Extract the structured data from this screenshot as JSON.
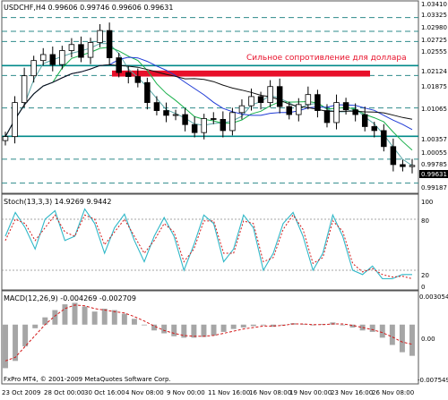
{
  "main_panel": {
    "header": "USDCHF,H4  0.99606 0.99746 0.99606 0.99631",
    "annotation": "Сильное сопротивление для доллара",
    "price_labels": [
      "1.03410",
      "1.03325",
      "1.02980",
      "1.02725",
      "1.02555",
      "1.02124",
      "1.01875",
      "1.01065",
      "1.00357",
      "1.00055",
      "0.99785",
      "0.99631",
      "0.99187"
    ]
  },
  "stoch_panel": {
    "header": "Stoch(13,3,3)  14.9269  9.9442",
    "scale": [
      "100",
      "80",
      "20",
      "0"
    ]
  },
  "macd_panel": {
    "header": "MACD(12,26,9) -0.004269 -0.002709",
    "scale": [
      "0.003054",
      "0.00",
      "-0.007549"
    ]
  },
  "footer": {
    "copyright": "FxPro MT4, © 2001-2009 MetaQuotes Software Corp.",
    "x_labels": [
      "23 Oct 2009",
      "28 Oct 00:00",
      "30 Oct 16:00",
      "4 Nov 08:00",
      "9 Nov 00:00",
      "11 Nov 16:00",
      "16 Nov 08:00",
      "19 Nov 00:00",
      "23 Nov 16:00",
      "26 Nov 08:00"
    ]
  },
  "colors": {
    "background": "#ffffff",
    "bull_candle": "#ffffff",
    "bear_candle": "#000000",
    "resistance_zone": "#e8102a",
    "resistance_line": "#008a8a",
    "dashed_levels": "#2e8b8b",
    "ma_blue": "#1f3bd6",
    "ma_green": "#18b04a",
    "ma_black": "#111111",
    "ma_teal": "#5aa7a7",
    "stoch_main": "#30b8c8",
    "stoch_signal": "#d21818",
    "macd_hist": "#a6a6a6",
    "macd_signal": "#d21818",
    "current_price_bg": "#000000"
  },
  "chart_data": [
    {
      "type": "line",
      "title": "USDCHF,H4",
      "series": [
        {
          "name": "USDCHF",
          "values": [
            1.0035,
            1.012,
            1.0187,
            1.0225,
            1.024,
            1.0215,
            1.025,
            1.0265,
            1.0233,
            1.027,
            1.03,
            1.0232,
            1.0195,
            1.0185,
            1.017,
            1.012,
            1.01,
            1.0088,
            1.009,
            1.0065,
            1.0045,
            1.008,
            1.0078,
            1.005,
            1.0095,
            1.0112,
            1.0135,
            1.012,
            1.016,
            1.011,
            1.009,
            1.0115,
            1.014,
            1.01,
            1.007,
            1.012,
            1.0102,
            1.009,
            1.006,
            1.005,
            1.001,
            0.9965,
            0.996,
            0.9963
          ]
        }
      ],
      "ylim": [
        0.99,
        1.0345
      ],
      "resistance_zone": [
        1.0185,
        1.02
      ],
      "horizontal_levels": [
        1.03325,
        1.0298,
        1.02725,
        1.02124,
        1.01875,
        1.01065,
        1.00357,
        0.99785,
        0.99187
      ],
      "grid": true
    },
    {
      "type": "line",
      "title": "Stoch(13,3,3)",
      "series": [
        {
          "name": "Stoch main",
          "values": [
            60,
            88,
            70,
            45,
            80,
            90,
            55,
            60,
            92,
            75,
            40,
            70,
            86,
            55,
            30,
            60,
            82,
            60,
            20,
            50,
            85,
            75,
            30,
            45,
            85,
            70,
            20,
            40,
            75,
            88,
            60,
            20,
            40,
            85,
            60,
            20,
            15,
            25,
            10,
            10,
            15,
            15
          ]
        },
        {
          "name": "Stoch signal",
          "values": [
            55,
            80,
            75,
            55,
            70,
            85,
            65,
            60,
            85,
            80,
            50,
            65,
            80,
            60,
            40,
            55,
            75,
            65,
            30,
            45,
            78,
            78,
            40,
            40,
            78,
            75,
            30,
            35,
            68,
            85,
            68,
            28,
            35,
            78,
            66,
            28,
            18,
            22,
            15,
            12,
            13,
            10
          ]
        }
      ],
      "ylim": [
        0,
        100
      ],
      "levels": [
        80,
        20
      ]
    },
    {
      "type": "bar",
      "title": "MACD(12,26,9)",
      "series": [
        {
          "name": "MACD",
          "values": [
            -0.006,
            -0.005,
            -0.003,
            -0.0005,
            0.001,
            0.002,
            0.0028,
            0.003,
            0.0025,
            0.0018,
            0.0022,
            0.002,
            0.0015,
            0.0008,
            0.0,
            -0.0008,
            -0.0012,
            -0.0016,
            -0.0018,
            -0.0018,
            -0.0017,
            -0.0015,
            -0.001,
            -0.0006,
            -0.0004,
            -0.0002,
            -0.0001,
            -0.0003,
            0.0,
            0.0002,
            0.0001,
            -0.0001,
            0.0001,
            0.0003,
            0.0,
            -0.0004,
            -0.0008,
            -0.001,
            -0.0018,
            -0.0028,
            -0.0038,
            -0.0043
          ]
        },
        {
          "name": "Signal",
          "values": [
            -0.005,
            -0.0045,
            -0.003,
            -0.0015,
            0.0,
            0.0012,
            0.0022,
            0.0027,
            0.0026,
            0.0022,
            0.002,
            0.0018,
            0.0016,
            0.0011,
            0.0005,
            -0.0002,
            -0.0008,
            -0.0012,
            -0.0015,
            -0.0016,
            -0.0016,
            -0.0015,
            -0.0012,
            -0.0009,
            -0.0006,
            -0.0004,
            -0.0002,
            -0.0002,
            -0.0001,
            0.0001,
            0.0001,
            0.0,
            0.0,
            0.0001,
            0.0001,
            -0.0001,
            -0.0004,
            -0.0007,
            -0.0011,
            -0.0017,
            -0.0024,
            -0.0027
          ]
        }
      ],
      "ylim": [
        -0.007549,
        0.003054
      ]
    }
  ]
}
